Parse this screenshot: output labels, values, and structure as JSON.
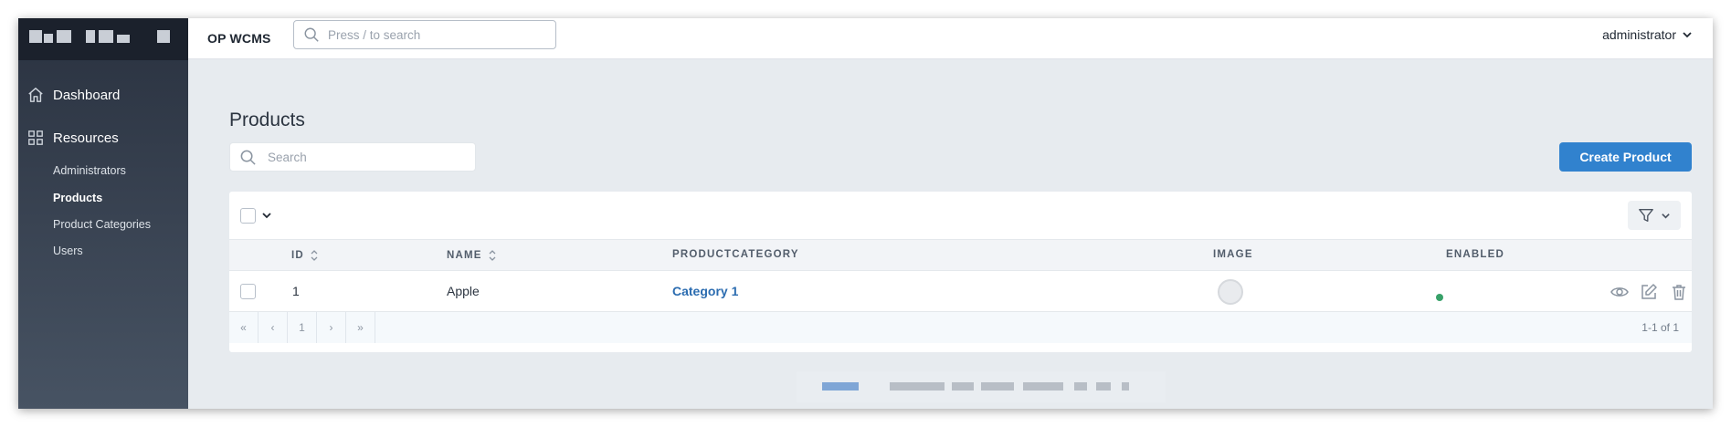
{
  "topbar": {
    "app_title": "OP WCMS",
    "search_placeholder": "Press / to search",
    "user_name": "administrator"
  },
  "sidebar": {
    "items": [
      {
        "label": "Dashboard",
        "icon": "home-icon"
      },
      {
        "label": "Resources",
        "icon": "grid-icon"
      }
    ],
    "sub_items": [
      {
        "label": "Administrators",
        "active": false
      },
      {
        "label": "Products",
        "active": true
      },
      {
        "label": "Product Categories",
        "active": false
      },
      {
        "label": "Users",
        "active": false
      }
    ]
  },
  "page": {
    "title": "Products",
    "search_placeholder": "Search",
    "create_button": "Create Product"
  },
  "table": {
    "columns": [
      "ID",
      "NAME",
      "PRODUCTCATEGORY",
      "IMAGE",
      "ENABLED"
    ],
    "rows": [
      {
        "id": "1",
        "name": "Apple",
        "category": "Category 1",
        "enabled": true
      }
    ]
  },
  "pagination": {
    "first": "«",
    "prev": "‹",
    "current": "1",
    "next": "›",
    "last": "»",
    "count": "1-1 of 1"
  },
  "colors": {
    "primary": "#3182ce",
    "link": "#2b6cb0",
    "enabled": "#38a169",
    "sidebar_top": "#2a3240"
  }
}
